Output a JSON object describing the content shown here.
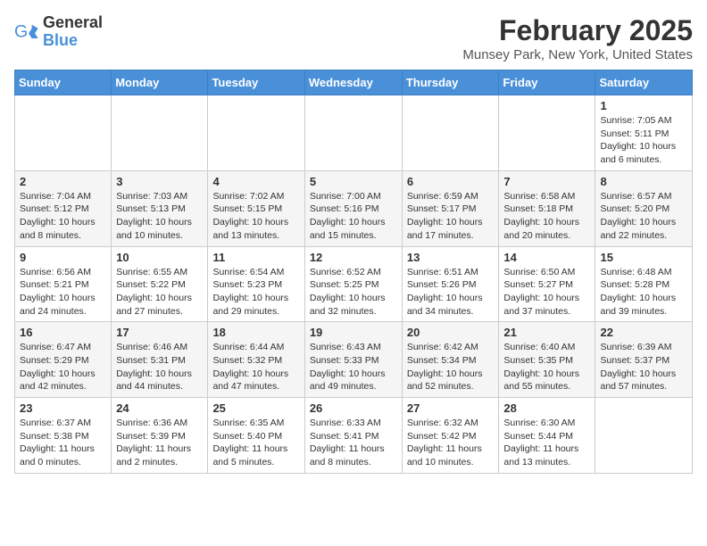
{
  "logo": {
    "general": "General",
    "blue": "Blue"
  },
  "title": "February 2025",
  "location": "Munsey Park, New York, United States",
  "days_of_week": [
    "Sunday",
    "Monday",
    "Tuesday",
    "Wednesday",
    "Thursday",
    "Friday",
    "Saturday"
  ],
  "weeks": [
    [
      {
        "day": "",
        "info": ""
      },
      {
        "day": "",
        "info": ""
      },
      {
        "day": "",
        "info": ""
      },
      {
        "day": "",
        "info": ""
      },
      {
        "day": "",
        "info": ""
      },
      {
        "day": "",
        "info": ""
      },
      {
        "day": "1",
        "info": "Sunrise: 7:05 AM\nSunset: 5:11 PM\nDaylight: 10 hours and 6 minutes."
      }
    ],
    [
      {
        "day": "2",
        "info": "Sunrise: 7:04 AM\nSunset: 5:12 PM\nDaylight: 10 hours and 8 minutes."
      },
      {
        "day": "3",
        "info": "Sunrise: 7:03 AM\nSunset: 5:13 PM\nDaylight: 10 hours and 10 minutes."
      },
      {
        "day": "4",
        "info": "Sunrise: 7:02 AM\nSunset: 5:15 PM\nDaylight: 10 hours and 13 minutes."
      },
      {
        "day": "5",
        "info": "Sunrise: 7:00 AM\nSunset: 5:16 PM\nDaylight: 10 hours and 15 minutes."
      },
      {
        "day": "6",
        "info": "Sunrise: 6:59 AM\nSunset: 5:17 PM\nDaylight: 10 hours and 17 minutes."
      },
      {
        "day": "7",
        "info": "Sunrise: 6:58 AM\nSunset: 5:18 PM\nDaylight: 10 hours and 20 minutes."
      },
      {
        "day": "8",
        "info": "Sunrise: 6:57 AM\nSunset: 5:20 PM\nDaylight: 10 hours and 22 minutes."
      }
    ],
    [
      {
        "day": "9",
        "info": "Sunrise: 6:56 AM\nSunset: 5:21 PM\nDaylight: 10 hours and 24 minutes."
      },
      {
        "day": "10",
        "info": "Sunrise: 6:55 AM\nSunset: 5:22 PM\nDaylight: 10 hours and 27 minutes."
      },
      {
        "day": "11",
        "info": "Sunrise: 6:54 AM\nSunset: 5:23 PM\nDaylight: 10 hours and 29 minutes."
      },
      {
        "day": "12",
        "info": "Sunrise: 6:52 AM\nSunset: 5:25 PM\nDaylight: 10 hours and 32 minutes."
      },
      {
        "day": "13",
        "info": "Sunrise: 6:51 AM\nSunset: 5:26 PM\nDaylight: 10 hours and 34 minutes."
      },
      {
        "day": "14",
        "info": "Sunrise: 6:50 AM\nSunset: 5:27 PM\nDaylight: 10 hours and 37 minutes."
      },
      {
        "day": "15",
        "info": "Sunrise: 6:48 AM\nSunset: 5:28 PM\nDaylight: 10 hours and 39 minutes."
      }
    ],
    [
      {
        "day": "16",
        "info": "Sunrise: 6:47 AM\nSunset: 5:29 PM\nDaylight: 10 hours and 42 minutes."
      },
      {
        "day": "17",
        "info": "Sunrise: 6:46 AM\nSunset: 5:31 PM\nDaylight: 10 hours and 44 minutes."
      },
      {
        "day": "18",
        "info": "Sunrise: 6:44 AM\nSunset: 5:32 PM\nDaylight: 10 hours and 47 minutes."
      },
      {
        "day": "19",
        "info": "Sunrise: 6:43 AM\nSunset: 5:33 PM\nDaylight: 10 hours and 49 minutes."
      },
      {
        "day": "20",
        "info": "Sunrise: 6:42 AM\nSunset: 5:34 PM\nDaylight: 10 hours and 52 minutes."
      },
      {
        "day": "21",
        "info": "Sunrise: 6:40 AM\nSunset: 5:35 PM\nDaylight: 10 hours and 55 minutes."
      },
      {
        "day": "22",
        "info": "Sunrise: 6:39 AM\nSunset: 5:37 PM\nDaylight: 10 hours and 57 minutes."
      }
    ],
    [
      {
        "day": "23",
        "info": "Sunrise: 6:37 AM\nSunset: 5:38 PM\nDaylight: 11 hours and 0 minutes."
      },
      {
        "day": "24",
        "info": "Sunrise: 6:36 AM\nSunset: 5:39 PM\nDaylight: 11 hours and 2 minutes."
      },
      {
        "day": "25",
        "info": "Sunrise: 6:35 AM\nSunset: 5:40 PM\nDaylight: 11 hours and 5 minutes."
      },
      {
        "day": "26",
        "info": "Sunrise: 6:33 AM\nSunset: 5:41 PM\nDaylight: 11 hours and 8 minutes."
      },
      {
        "day": "27",
        "info": "Sunrise: 6:32 AM\nSunset: 5:42 PM\nDaylight: 11 hours and 10 minutes."
      },
      {
        "day": "28",
        "info": "Sunrise: 6:30 AM\nSunset: 5:44 PM\nDaylight: 11 hours and 13 minutes."
      },
      {
        "day": "",
        "info": ""
      }
    ]
  ]
}
